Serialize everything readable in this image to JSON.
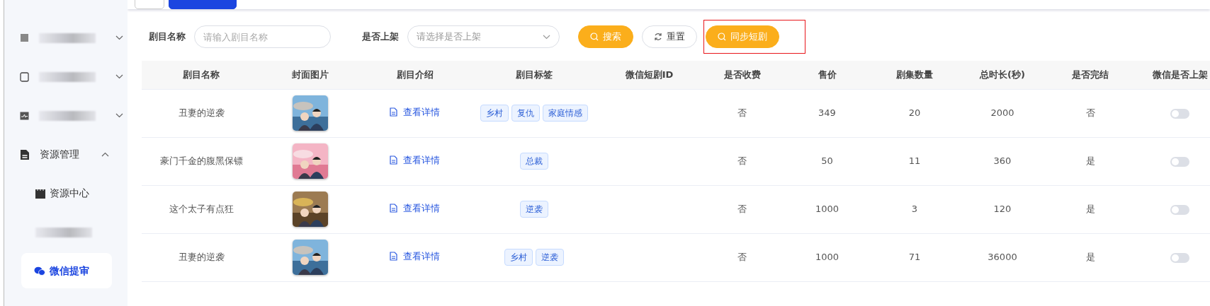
{
  "sidebar": {
    "items": [
      {
        "kind": "redacted",
        "expanded": false
      },
      {
        "kind": "redacted",
        "expanded": false
      },
      {
        "kind": "redacted",
        "expanded": false
      },
      {
        "kind": "menu",
        "label": "资源管理",
        "expanded": true,
        "children": [
          {
            "kind": "menu",
            "label": "资源中心",
            "selected": false
          },
          {
            "kind": "redacted",
            "selected": false
          },
          {
            "kind": "menu",
            "label": "微信提审",
            "selected": true
          }
        ]
      }
    ]
  },
  "filters": [
    {
      "kind": "input",
      "label": "剧目名称",
      "placeholder": "请输入剧目名称"
    },
    {
      "kind": "select",
      "label": "是否上架",
      "placeholder": "请选择是否上架"
    }
  ],
  "buttons": [
    {
      "kind": "primary",
      "label": "搜索",
      "highlighted": false
    },
    {
      "kind": "outline",
      "label": "重置",
      "highlighted": false
    },
    {
      "kind": "primary",
      "label": "同步短剧",
      "highlighted": true
    }
  ],
  "table": {
    "columns": [
      "剧目名称",
      "封面图片",
      "剧目介绍",
      "剧目标签",
      "微信短剧ID",
      "是否收费",
      "售价",
      "剧集数量",
      "总时长(秒)",
      "是否完结",
      "微信是否上架"
    ],
    "rows": [
      {
        "name": "丑妻的逆袭",
        "cover": {
          "kind": "picture"
        },
        "intro": "查看详情",
        "tags": [
          "乡村",
          "复仇",
          "家庭情感"
        ],
        "paid": "否",
        "price": "349",
        "episodes": "20",
        "duration": "2000",
        "finished": "否",
        "wechat_on": false
      },
      {
        "name": "豪门千金的腹黑保镖",
        "cover": {
          "kind": "picture"
        },
        "intro": "查看详情",
        "tags": [
          "总裁"
        ],
        "paid": "否",
        "price": "50",
        "episodes": "11",
        "duration": "360",
        "finished": "是",
        "wechat_on": false
      },
      {
        "name": "这个太子有点狂",
        "cover": {
          "kind": "picture"
        },
        "intro": "查看详情",
        "tags": [
          "逆袭"
        ],
        "paid": "否",
        "price": "1000",
        "episodes": "3",
        "duration": "120",
        "finished": "是",
        "wechat_on": false
      },
      {
        "name": "丑妻的逆袭",
        "cover": {
          "kind": "picture"
        },
        "intro": "查看详情",
        "tags": [
          "乡村",
          "逆袭"
        ],
        "paid": "否",
        "price": "1000",
        "episodes": "71",
        "duration": "36000",
        "finished": "是",
        "wechat_on": false
      }
    ]
  }
}
